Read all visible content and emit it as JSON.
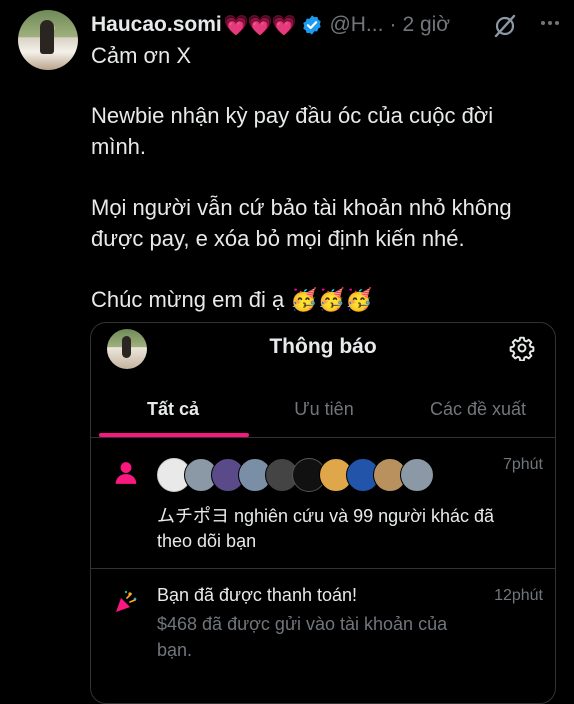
{
  "tweet": {
    "author_name": "Haucao.somi",
    "author_hearts": "💗💗💗",
    "handle": "@H...",
    "separator": "·",
    "time": "2 giờ",
    "line1": "Cảm ơn X",
    "line2": "Newbie nhận kỳ pay đầu óc của cuộc đời mình.",
    "line3": "Mọi người vẫn cứ bảo tài khoản nhỏ không được pay, e xóa bỏ mọi định kiến nhé.",
    "line4": "Chúc mừng em đi ạ 🥳🥳🥳"
  },
  "notifications_card": {
    "title": "Thông báo",
    "tabs": [
      {
        "label": "Tất cả",
        "active": true
      },
      {
        "label": "Ưu tiên",
        "active": false
      },
      {
        "label": "Các đề xuất",
        "active": false
      }
    ],
    "accent_color": "#f91880",
    "items": [
      {
        "icon": "person-icon",
        "time": "7phút",
        "text": "ムチポヨ nghiên cứu và 99 người khác đã theo dõi bạn"
      },
      {
        "icon": "party-popper-icon",
        "time": "12phút",
        "title": "Bạn đã được thanh toán!",
        "body": "$468 đã được gửi vào tài khoản của bạn."
      }
    ]
  },
  "colors": {
    "background": "#000000",
    "text": "#e7e9ea",
    "muted": "#71767b",
    "verified": "#1d9bf0",
    "border": "#2f3336"
  }
}
